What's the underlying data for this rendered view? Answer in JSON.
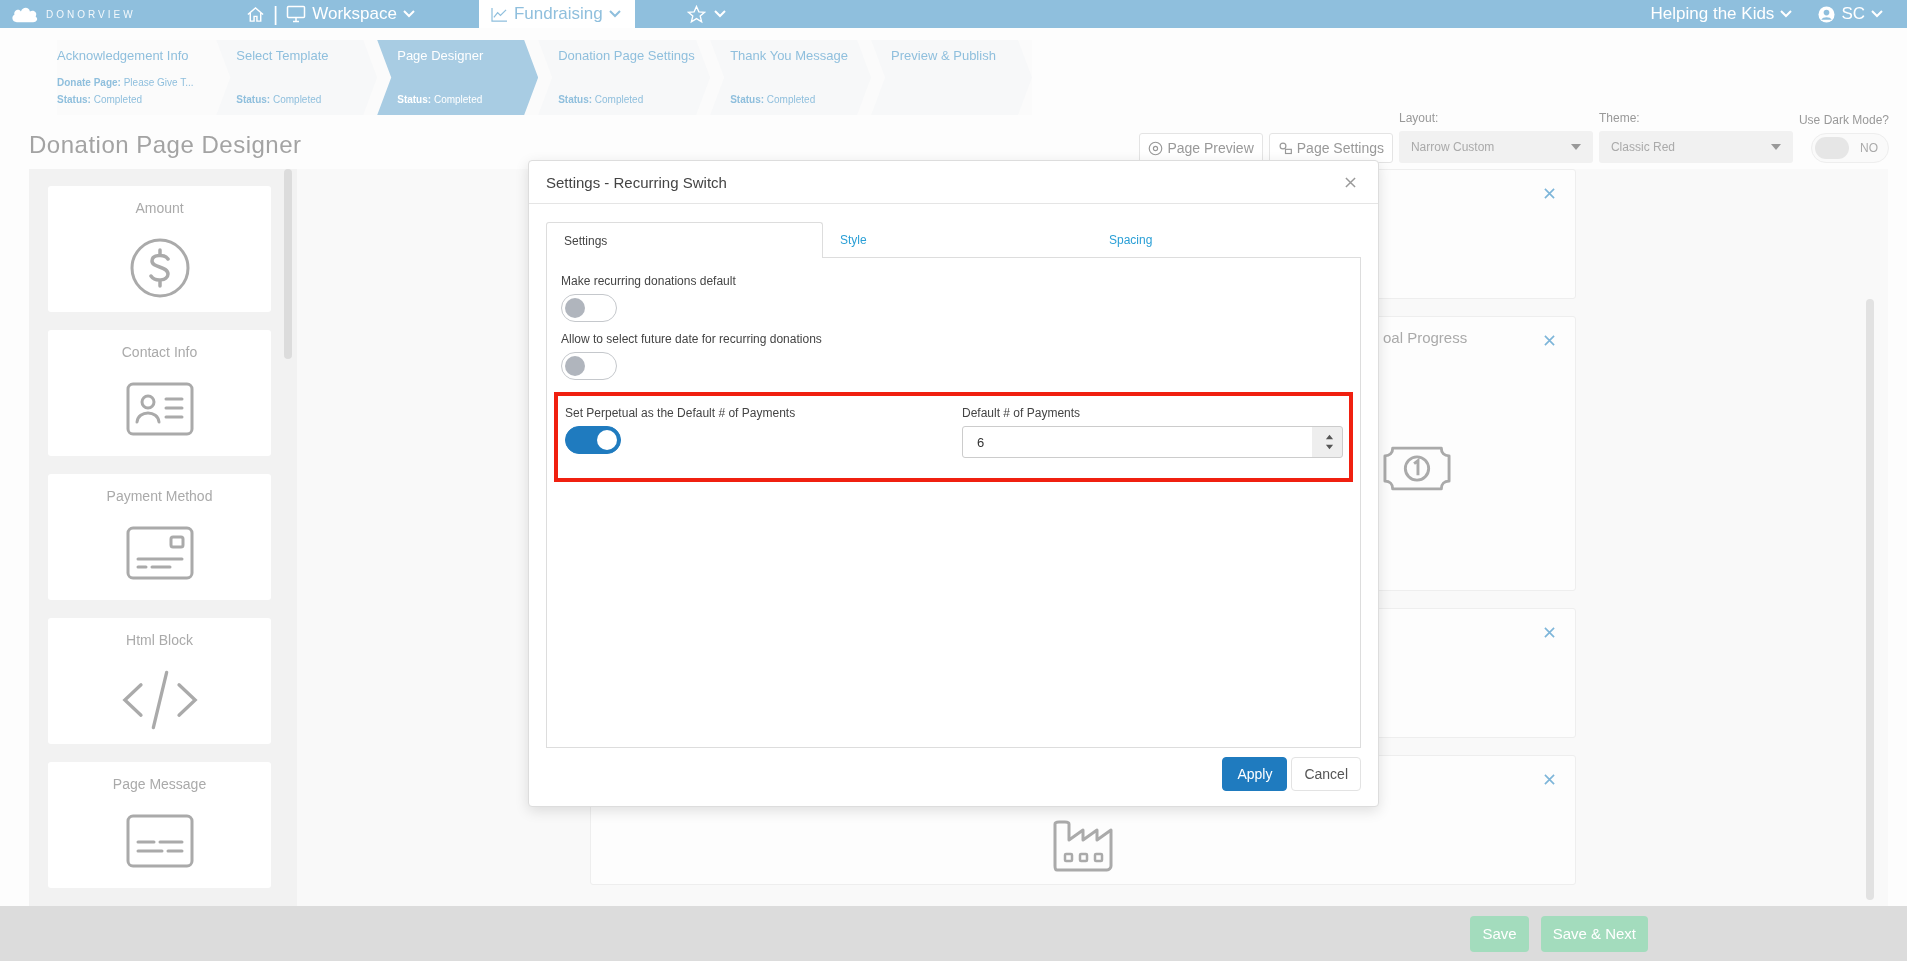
{
  "nav": {
    "brand": "DONORVIEW",
    "separator": "|",
    "menus": [
      {
        "label": "Workspace",
        "selected": false
      },
      {
        "label": "Fundraising",
        "selected": true
      }
    ],
    "org": "Helping the Kids",
    "user": "SC"
  },
  "steps": [
    {
      "title": "Acknowledgement Info",
      "detail": "**Donate Page:** Please Give T...",
      "status": "**Status:** Completed",
      "selected": false
    },
    {
      "title": "Select Template",
      "status": "**Status:** Completed",
      "selected": false
    },
    {
      "title": "Page Designer",
      "status": "**Status:** Completed",
      "selected": true
    },
    {
      "title": "Donation Page Settings",
      "status": "**Status:** Completed",
      "selected": false
    },
    {
      "title": "Thank You Message",
      "status": "**Status:** Completed",
      "selected": false
    },
    {
      "title": "Preview & Publish",
      "selected": false
    }
  ],
  "page_title": "Donation Page Designer",
  "toolbar": {
    "buttons": [
      {
        "kind": "preview",
        "label": "Page Preview"
      },
      {
        "kind": "settings",
        "label": "Page Settings"
      }
    ],
    "layout": {
      "label": "Layout:",
      "value": "Narrow Custom"
    },
    "theme": {
      "label": "Theme:",
      "value": "Classic Red"
    },
    "dark_mode": {
      "label": "Use Dark Mode?",
      "on": false,
      "state_text": "NO"
    }
  },
  "palette": [
    {
      "label": "Amount",
      "kind": "amount"
    },
    {
      "label": "Contact Info",
      "kind": "contact"
    },
    {
      "label": "Payment Method",
      "kind": "payment"
    },
    {
      "label": "Html Block",
      "kind": "html"
    },
    {
      "label": "Page Message",
      "kind": "message"
    }
  ],
  "canvas": {
    "blocks": [
      {
        "kind": "blank"
      },
      {
        "kind": "money",
        "title": "oal Progress"
      },
      {
        "kind": "blank"
      },
      {
        "kind": "factory"
      }
    ]
  },
  "modal": {
    "title": "Settings - Recurring Switch",
    "tabs": [
      {
        "label": "Settings",
        "selected": true
      },
      {
        "label": "Style",
        "selected": false
      },
      {
        "label": "Spacing",
        "selected": false
      }
    ],
    "toggles": [
      {
        "label": "Make recurring donations default",
        "on": false
      },
      {
        "label": "Allow to select future date for recurring donations",
        "on": false
      },
      {
        "label": "Set Perpetual as the Default # of Payments",
        "on": true
      }
    ],
    "payments": {
      "label": "Default # of Payments",
      "value": "6"
    },
    "buttons": [
      {
        "kind": "primary",
        "label": "Apply"
      },
      {
        "kind": "secondary",
        "label": "Cancel"
      }
    ]
  },
  "footer": {
    "buttons": [
      {
        "label": "Save",
        "disabled": true
      },
      {
        "label": "Save & Next",
        "disabled": true
      }
    ]
  }
}
